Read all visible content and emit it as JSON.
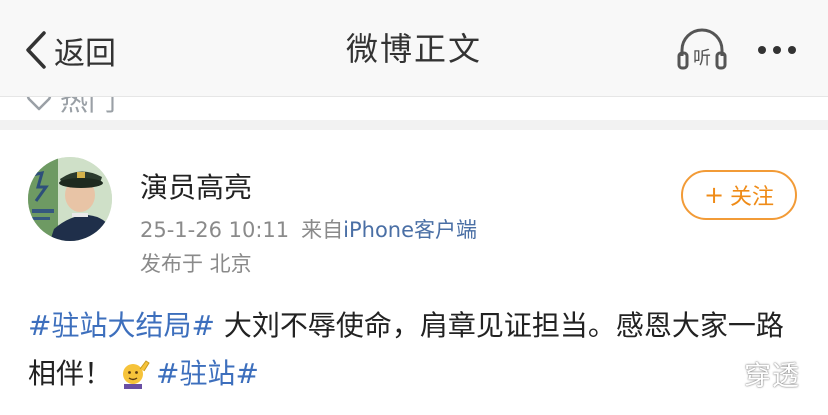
{
  "navbar": {
    "back_label": "返回",
    "title": "微博正文",
    "listen_label": "听",
    "back_icon": "chevron-left-icon",
    "more_icon": "more-dots-icon"
  },
  "hot_tab": {
    "label": "热门",
    "icon": "heart-icon"
  },
  "post": {
    "username": "演员高亮",
    "timestamp": "25-1-26 10:11",
    "source_prefix": "来自",
    "source_device": "iPhone客户端",
    "location": "发布于 北京",
    "follow_label": "关注",
    "follow_plus": "+",
    "content": {
      "hashtag1": "#驻站大结局#",
      "text": " 大刘不辱使命，肩章见证担当。感恩大家一路相伴！",
      "hashtag2": "#驻站#"
    }
  },
  "watermark": "穿透",
  "colors": {
    "accent_orange": "#ef8b17",
    "hashtag_blue": "#3d6fbd",
    "device_blue": "#4a6fa5",
    "meta_gray": "#8a8a8a"
  }
}
